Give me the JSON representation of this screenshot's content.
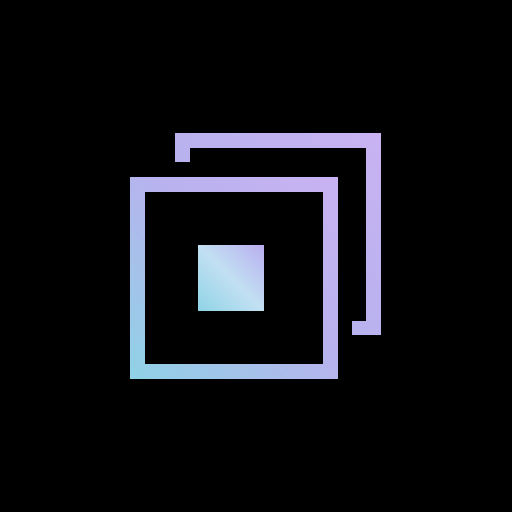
{
  "background_color": "#000000",
  "icon": {
    "name": "stacked-frames-icon",
    "gradient_start_color": "#8fd3e6",
    "gradient_mid_color": "#b8b2ee",
    "gradient_end_color": "#c9b2f2",
    "back_frame_color": "#c3b4f0",
    "front_frame_color": "#9fcfe6",
    "inner_square_color": "#a7c8ee"
  }
}
